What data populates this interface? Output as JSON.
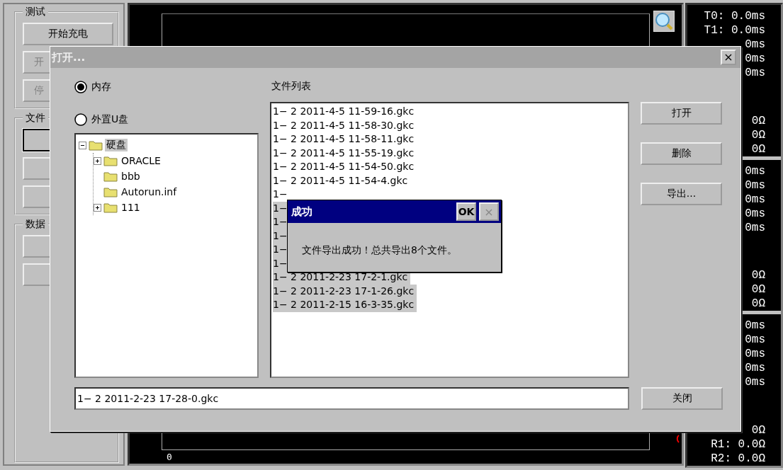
{
  "left_panel": {
    "groups": [
      {
        "title": "测试",
        "buttons": [
          {
            "label": "开始充电",
            "disabled": false,
            "focused": false
          },
          {
            "label": "开",
            "disabled": true,
            "focused": false
          },
          {
            "label": "停",
            "disabled": true,
            "focused": false
          }
        ]
      },
      {
        "title": "文件",
        "buttons": [
          {
            "focused": true
          },
          {
            "focused": false
          },
          {
            "focused": false
          }
        ]
      },
      {
        "title": "数据",
        "buttons": [
          {
            "focused": false
          },
          {
            "focused": false
          }
        ]
      }
    ]
  },
  "scope": {
    "axis_label": "0"
  },
  "readouts": {
    "sections": [
      {
        "times": [
          "T0: 0.0ms",
          "T1: 0.0ms",
          "0ms",
          "0ms",
          "0ms"
        ],
        "resistances": [
          "0Ω",
          "0Ω",
          "0Ω"
        ]
      },
      {
        "times": [
          "0ms",
          "0ms",
          "0ms",
          "0ms",
          "0ms"
        ],
        "resistances": [
          "0Ω",
          "0Ω",
          "0Ω"
        ]
      },
      {
        "times": [
          "0ms",
          "0ms",
          "0ms",
          "0ms",
          "0ms"
        ],
        "resistances": [
          "0Ω",
          "R1: 0.0Ω",
          "R2: 0.0Ω"
        ]
      }
    ]
  },
  "dialog": {
    "title": "打开...",
    "close": "×",
    "storage": [
      {
        "label": "内存",
        "selected": true
      },
      {
        "label": "外置U盘",
        "selected": false
      }
    ],
    "tree": [
      {
        "label": "硬盘",
        "selected": true,
        "expanded": true,
        "children": [
          {
            "label": "ORACLE",
            "selected": false,
            "expanded": false
          },
          {
            "label": "bbb",
            "selected": false
          },
          {
            "label": "Autorun.inf",
            "selected": false
          },
          {
            "label": "111",
            "selected": false,
            "expanded": false
          }
        ]
      }
    ],
    "file_list_label": "文件列表",
    "files": [
      {
        "name": "1− 2 2011-4-5 11-59-16.gkc",
        "selected": false
      },
      {
        "name": "1− 2 2011-4-5 11-58-30.gkc",
        "selected": false
      },
      {
        "name": "1− 2 2011-4-5 11-58-11.gkc",
        "selected": false
      },
      {
        "name": "1− 2 2011-4-5 11-55-19.gkc",
        "selected": false
      },
      {
        "name": "1− 2 2011-4-5 11-54-50.gkc",
        "selected": false
      },
      {
        "name": "1− 2 2011-4-5 11-54-4.gkc",
        "selected": false
      },
      {
        "name": "1−",
        "selected": false
      },
      {
        "name": "1−",
        "selected": true
      },
      {
        "name": "1−",
        "selected": true
      },
      {
        "name": "1−",
        "selected": true
      },
      {
        "name": "1−",
        "selected": true
      },
      {
        "name": "1−",
        "selected": true
      },
      {
        "name": "1− 2 2011-2-23 17-2-1.gkc",
        "selected": true
      },
      {
        "name": "1− 2 2011-2-23 17-1-26.gkc",
        "selected": true
      },
      {
        "name": "1− 2 2011-2-15 16-3-35.gkc",
        "selected": true
      }
    ],
    "actions": [
      {
        "label": "打开"
      },
      {
        "label": "删除"
      },
      {
        "label": "导出..."
      }
    ],
    "filename_field": {
      "value": "1− 2 2011-2-23 17-28-0.gkc"
    },
    "close_button": {
      "label": "关闭"
    }
  },
  "message_box": {
    "title": "成功",
    "ok": "OK",
    "close": {
      "label": "×",
      "disabled": true
    },
    "message": "文件导出成功！总共导出8个文件。"
  }
}
